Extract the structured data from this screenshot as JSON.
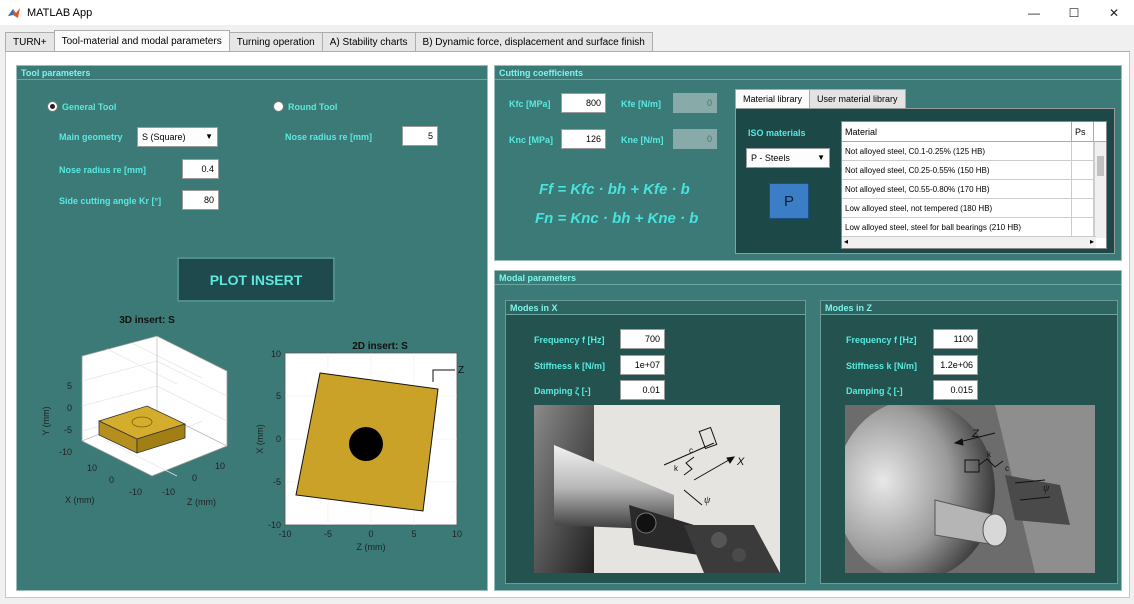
{
  "window": {
    "title": "MATLAB App",
    "minimize": "—",
    "maximize": "☐",
    "close": "✕"
  },
  "tabs": [
    {
      "label": "TURN+"
    },
    {
      "label": "Tool-material and modal parameters"
    },
    {
      "label": "Turning operation"
    },
    {
      "label": "A) Stability charts"
    },
    {
      "label": "B) Dynamic force, displacement and surface finish"
    }
  ],
  "tool": {
    "panel_title": "Tool parameters",
    "general_tool": "General Tool",
    "round_tool": "Round Tool",
    "main_geometry_label": "Main geometry",
    "main_geometry_value": "S (Square)",
    "nose_radius_right_label": "Nose radius re [mm]",
    "nose_radius_right_value": "5",
    "nose_radius_label": "Nose radius re [mm]",
    "nose_radius_value": "0.4",
    "side_angle_label": "Side cutting angle Kr [°]",
    "side_angle_value": "80",
    "plot_button": "PLOT INSERT"
  },
  "plot3d": {
    "title": "3D insert: S",
    "xlabel": "X (mm)",
    "ylabel": "Y (mm)",
    "zlabel": "Z (mm)",
    "yticks": [
      "5",
      "0",
      "-5",
      "-10"
    ],
    "xticks": [
      "10",
      "0",
      "-10"
    ],
    "zticks": [
      "-10",
      "0",
      "10"
    ],
    "insert_color": "#c9a227"
  },
  "plot2d": {
    "title": "2D insert: S",
    "xlabel": "Z (mm)",
    "ylabel": "X (mm)",
    "yticks": [
      "10",
      "5",
      "0",
      "-5",
      "-10"
    ],
    "xticks": [
      "-10",
      "-5",
      "0",
      "5",
      "10"
    ],
    "axis_label": "Z",
    "insert_color": "#c9a227"
  },
  "cutting": {
    "panel_title": "Cutting coefficients",
    "kfc_label": "Kfc [MPa]",
    "kfc_value": "800",
    "kfe_label": "Kfe [N/m]",
    "kfe_value": "0",
    "knc_label": "Knc [MPa]",
    "knc_value": "126",
    "kne_label": "Kne [N/m]",
    "kne_value": "0",
    "formula1": "Ff = Kfc · bh +  Kfe · b",
    "formula2": "Fn = Knc · bh +  Kne · b"
  },
  "library": {
    "tab1": "Material library",
    "tab2": "User material library",
    "iso_label": "ISO materials",
    "iso_value": "P - Steels",
    "p_tile": "P",
    "col_material": "Material",
    "col_ps": "Ps",
    "rows": [
      "Not alloyed steel, C0.1-0.25% (125 HB)",
      "Not alloyed steel, C0.25-0.55% (150 HB)",
      "Not alloyed steel, C0.55-0.80% (170 HB)",
      "Low alloyed steel, not tempered (180 HB)",
      "Low alloyed steel, steel for ball bearings (210 HB)"
    ]
  },
  "modal": {
    "panel_title": "Modal parameters",
    "x": {
      "title": "Modes in X",
      "freq_label": "Frequency f [Hz]",
      "freq_value": "700",
      "stiff_label": "Stiffness k [N/m]",
      "stiff_value": "1e+07",
      "damp_label": "Damping ζ [-]",
      "damp_value": "0.01"
    },
    "z": {
      "title": "Modes in Z",
      "freq_label": "Frequency f [Hz]",
      "freq_value": "1100",
      "stiff_label": "Stiffness k [N/m]",
      "stiff_value": "1.2e+06",
      "damp_label": "Damping ζ [-]",
      "damp_value": "0.015"
    },
    "photo_x_labels": {
      "x": "X",
      "psi": "ψ",
      "k": "k",
      "c": "c"
    },
    "photo_z_labels": {
      "z": "Z",
      "psi": "ψ",
      "k": "k",
      "c": "c"
    }
  }
}
